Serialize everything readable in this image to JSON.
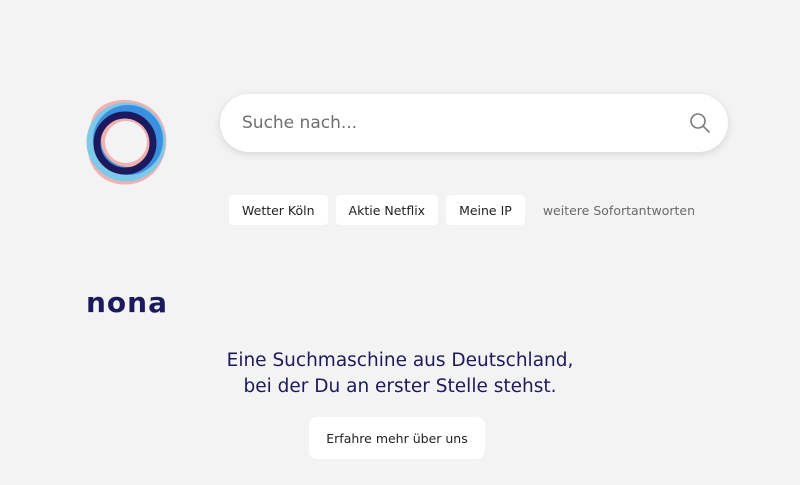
{
  "logo": {
    "text": "nona",
    "colors": [
      "#1c1a5c",
      "#3b8fe0",
      "#f2a3a3",
      "#7ec8e8"
    ]
  },
  "search": {
    "placeholder": "Suche nach...",
    "value": "",
    "icon": "search-icon"
  },
  "quick_answers": {
    "chips": [
      "Wetter Köln",
      "Aktie Netflix",
      "Meine IP"
    ],
    "more_link": "weitere Sofortantworten"
  },
  "tagline": {
    "line1": "Eine Suchmaschine aus Deutschland,",
    "line2": "bei der Du an erster Stelle stehst."
  },
  "cta": {
    "label": "Erfahre mehr über uns"
  },
  "colors": {
    "background": "#f3f3f3",
    "brand_navy": "#1c1a5c"
  }
}
